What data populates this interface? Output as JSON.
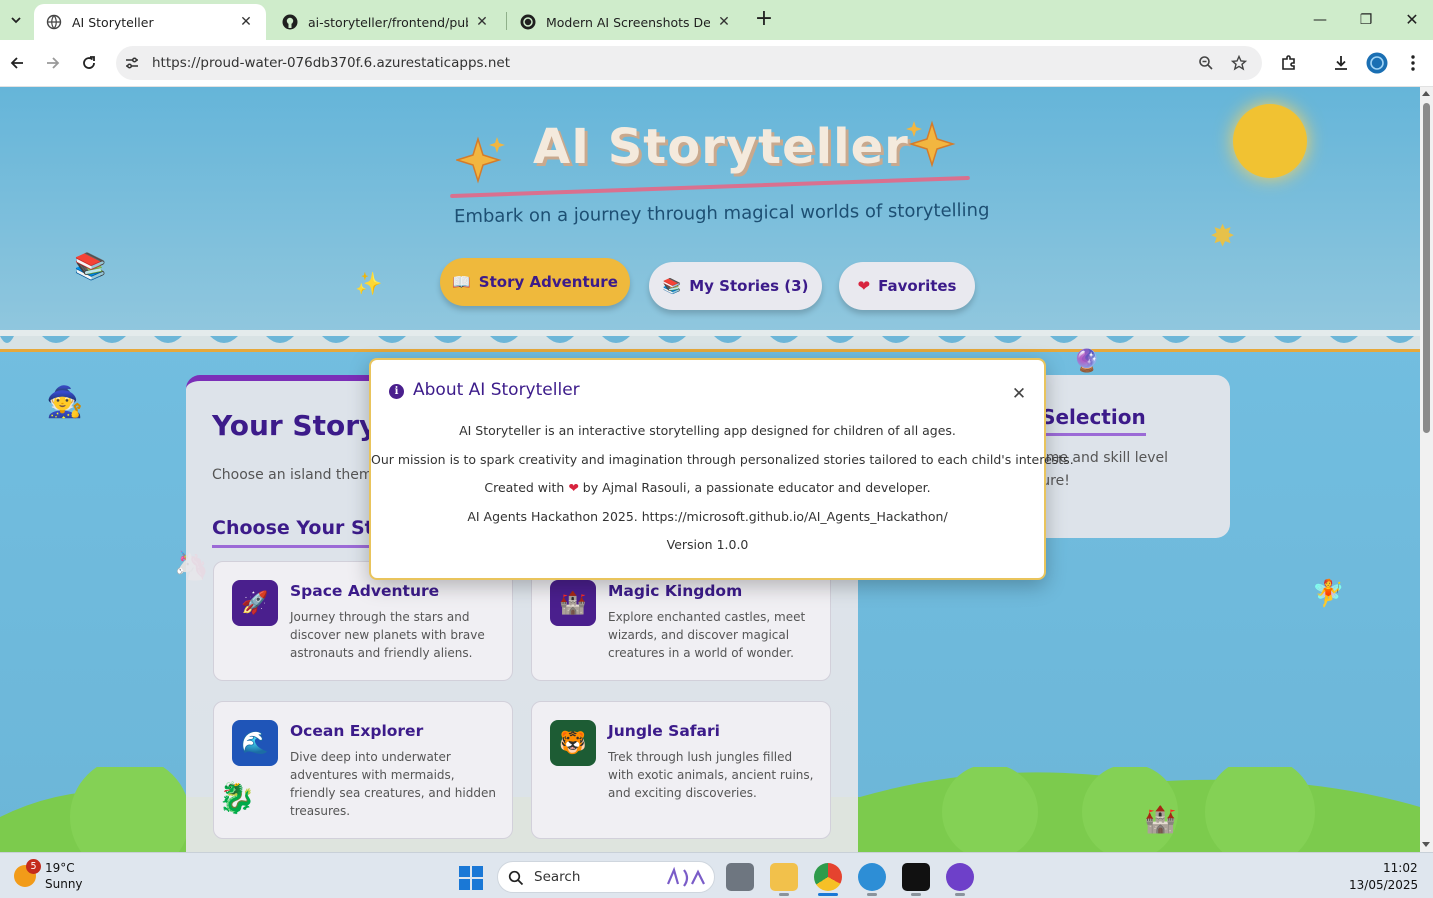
{
  "browser": {
    "tabs": [
      {
        "title": "AI Storyteller",
        "active": true
      },
      {
        "title": "ai-storyteller/frontend/public/in",
        "active": false
      },
      {
        "title": "Modern AI Screenshots Design",
        "active": false
      }
    ],
    "url": "https://proud-water-076db370f.6.azurestaticapps.net"
  },
  "header": {
    "title": "AI Storyteller",
    "subtitle": "Embark on a journey through magical worlds of storytelling"
  },
  "nav": [
    {
      "label": "Story Adventure",
      "icon": "open-book-icon"
    },
    {
      "label": "My Stories (3)",
      "icon": "books-icon"
    },
    {
      "label": "Favorites",
      "icon": "heart-icon"
    }
  ],
  "main": {
    "title": "Your Story A",
    "subtitle": "Choose an island them",
    "choose_label": "Choose Your Stor",
    "themes": [
      {
        "name": "Space Adventure",
        "description": "Journey through the stars and discover new planets with brave astronauts and friendly aliens.",
        "icon": "rocket-icon"
      },
      {
        "name": "Magic Kingdom",
        "description": "Explore enchanted castles, meet wizards, and discover magical creatures in a world of wonder.",
        "icon": "castle-icon"
      },
      {
        "name": "Ocean Explorer",
        "description": "Dive deep into underwater adventures with mermaids, friendly sea creatures, and hidden treasures.",
        "icon": "wave-icon"
      },
      {
        "name": "Jungle Safari",
        "description": "Trek through lush jungles filled with exotic animals, ancient ruins, and exciting discoveries.",
        "icon": "tiger-icon"
      }
    ]
  },
  "side": {
    "title": "ur Selection",
    "text_line1": "y theme and skill level",
    "text_line2": "venture!"
  },
  "modal": {
    "title": "About AI Storyteller",
    "line1": "AI Storyteller is an interactive storytelling app designed for children of all ages.",
    "line2": "Our mission is to spark creativity and imagination through personalized stories tailored to each child's interests.",
    "line3_before": "Created with",
    "line3_after": "by Ajmal Rasouli, a passionate educator and developer.",
    "line4": "AI Agents Hackathon 2025. https://microsoft.github.io/AI_Agents_Hackathon/",
    "line5": "Version 1.0.0"
  },
  "taskbar": {
    "weather_badge": "5",
    "temperature": "19°C",
    "condition": "Sunny",
    "search_label": "Search",
    "time": "11:02",
    "date": "13/05/2025"
  },
  "colors": {
    "sky": "#6ab8da",
    "accent_purple": "#3c1b8a",
    "gold": "#efb93c",
    "tab_strip": "#cfeccb"
  }
}
